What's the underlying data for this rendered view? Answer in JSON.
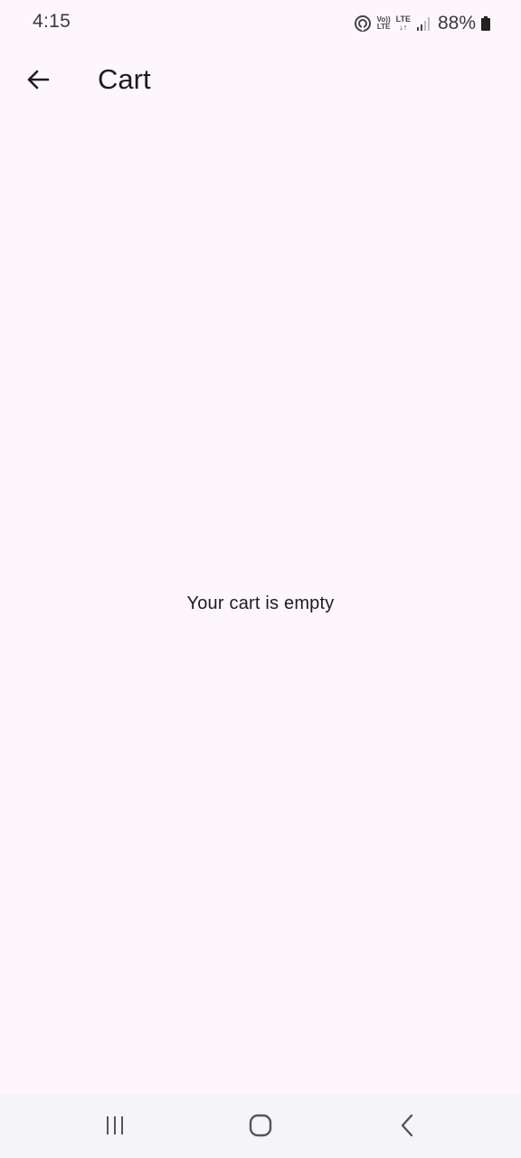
{
  "status_bar": {
    "time": "4:15",
    "volte_top": "Vo))",
    "volte_bottom": "LTE",
    "lte_top": "LTE",
    "lte_bottom": "↓↑",
    "battery": "88%",
    "icons": [
      "hotspot-icon",
      "volte-icon",
      "lte-icon",
      "signal-icon",
      "battery-icon"
    ]
  },
  "app_bar": {
    "title": "Cart",
    "back_icon": "arrow-back-icon"
  },
  "content": {
    "empty_message": "Your cart is empty"
  },
  "nav_bar": {
    "icons": [
      "recents-icon",
      "home-icon",
      "back-icon"
    ]
  },
  "colors": {
    "background": "#fdf7fd",
    "nav_background": "#f5f4f8",
    "text": "#1d1b20"
  }
}
